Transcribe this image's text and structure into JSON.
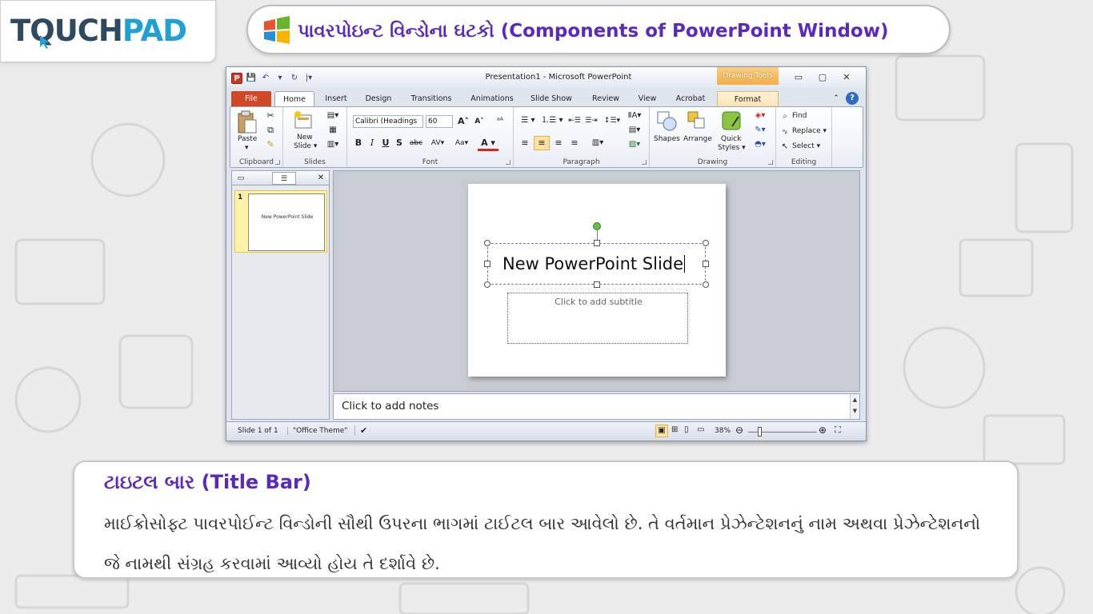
{
  "logo": {
    "part1": "TQUCH",
    "part2": "PAD"
  },
  "header": {
    "title": "પાવરપોઇન્ટ વિન્ડોના ઘટકો (Components of PowerPoint Window)"
  },
  "ppt": {
    "quick_access": [
      "P",
      "💾",
      "↶",
      "▾",
      "↻",
      "|▾"
    ],
    "window_title": "Presentation1 - Microsoft PowerPoint",
    "contextual_tab": "Drawing Tools",
    "window_controls": [
      "▭",
      "▢",
      "✕"
    ],
    "tabs": [
      "File",
      "Home",
      "Insert",
      "Design",
      "Transitions",
      "Animations",
      "Slide Show",
      "Review",
      "View",
      "Acrobat",
      "Format"
    ],
    "ribbon": {
      "clipboard": {
        "paste": "Paste",
        "label": "Clipboard"
      },
      "slides": {
        "new_slide": "New",
        "new_slide2": "Slide ▾",
        "label": "Slides"
      },
      "font": {
        "name": "Calibri (Headings",
        "size": "60",
        "grow": "A˄",
        "shrink": "A˅",
        "clear": "ᵃᴬ",
        "bold": "B",
        "italic": "I",
        "underline": "U",
        "shadow": "S",
        "strike": "abc",
        "spacing": "AV▾",
        "case": "Aa▾",
        "color": "A ▾",
        "label": "Font"
      },
      "paragraph": {
        "bullets": "☰ ▾",
        "numbering": "⒈☰ ▾",
        "dec_indent": "⇤☰",
        "inc_indent": "☰⇥",
        "line_spacing": "↕☰▾",
        "columns": "▥▾",
        "align_left": "≡",
        "align_center": "≡",
        "align_right": "≡",
        "justify": "≡",
        "label": "Paragraph"
      },
      "drawing": {
        "shapes": "Shapes",
        "arrange": "Arrange",
        "quick": "Quick",
        "styles": "Styles ▾",
        "label": "Drawing"
      },
      "editing": {
        "find": "Find",
        "replace": "Replace ▾",
        "select": "Select ▾",
        "label": "Editing"
      }
    },
    "thumbnail": {
      "slide_number": "1",
      "slide_text": "New PowerPoint Slide",
      "close": "✕"
    },
    "slide": {
      "title": "New PowerPoint Slide",
      "subtitle_placeholder": "Click to add subtitle"
    },
    "notes": {
      "placeholder": "Click to add notes"
    },
    "status": {
      "slide": "Slide 1 of 1",
      "theme": "\"Office Theme\"",
      "zoom": "38%"
    }
  },
  "info": {
    "heading": "ટાઇટલ બાર (Title Bar)",
    "body": "માઈક્રોસોફ્ટ પાવરપોઈન્ટ વિન્ડોની સૌથી ઉપરના ભાગમાં ટાઈટલ બાર આવેલો છે. તે વર્તમાન પ્રેઝેન્ટેશનનું નામ અથવા પ્રેઝેન્ટેશનનો જે નામથી સંગ્રહ કરવામાં આવ્યો હોય તે દર્શાવે છે."
  },
  "colors": {
    "purple": "#5a2bb8",
    "blue": "#21a0d5",
    "file_tab": "#d24726",
    "ctx_orange": "#f2ae44"
  }
}
